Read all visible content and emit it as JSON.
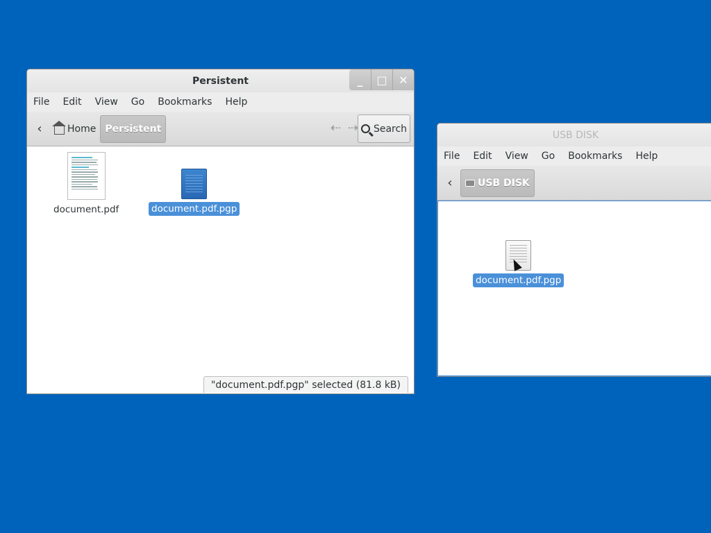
{
  "windows": {
    "persistent": {
      "title": "Persistent",
      "menu": [
        "File",
        "Edit",
        "View",
        "Go",
        "Bookmarks",
        "Help"
      ],
      "breadcrumbs": [
        "Home",
        "Persistent"
      ],
      "search_label": "Search",
      "files": [
        {
          "name": "document.pdf",
          "icon": "pdf-thumbnail",
          "selected": false
        },
        {
          "name": "document.pdf.pgp",
          "icon": "blue-document-icon",
          "selected": true
        }
      ],
      "status": "\"document.pdf.pgp\" selected (81.8 kB)"
    },
    "usb": {
      "title": "USB DISK",
      "menu": [
        "File",
        "Edit",
        "View",
        "Go",
        "Bookmarks",
        "Help"
      ],
      "breadcrumbs": [
        "USB DISK"
      ],
      "files": [
        {
          "name": "document.pdf.pgp",
          "icon": "white-document-icon",
          "selected": true
        }
      ]
    }
  },
  "icons": {
    "back": "‹",
    "history_back": "⇠",
    "history_forward": "⇢",
    "minimize": "_",
    "maximize": "□",
    "close": "✕"
  },
  "colors": {
    "desktop": "#0063bb",
    "selection": "#4a90d9"
  }
}
